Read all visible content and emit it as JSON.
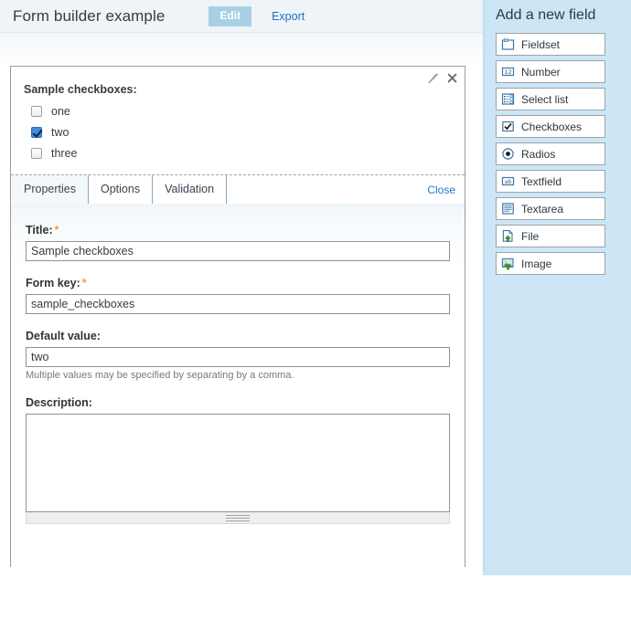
{
  "header": {
    "title": "Form builder example",
    "edit_label": "Edit",
    "export_label": "Export"
  },
  "preview": {
    "label": "Sample checkboxes:",
    "edit_icon": "pencil-icon",
    "close_icon": "close-icon",
    "checkboxes": [
      {
        "label": "one",
        "checked": false
      },
      {
        "label": "two",
        "checked": true
      },
      {
        "label": "three",
        "checked": false
      }
    ]
  },
  "tabs": {
    "items": [
      {
        "label": "Properties",
        "active": true
      },
      {
        "label": "Options",
        "active": false
      },
      {
        "label": "Validation",
        "active": false
      }
    ],
    "close_label": "Close"
  },
  "properties": {
    "title": {
      "label": "Title:",
      "required_marker": "*",
      "value": "Sample checkboxes",
      "placeholder": ""
    },
    "form_key": {
      "label": "Form key:",
      "required_marker": "*",
      "value": "sample_checkboxes",
      "placeholder": ""
    },
    "default_value": {
      "label": "Default value:",
      "value": "two",
      "placeholder": "",
      "hint": "Multiple values may be specified by separating by a comma."
    },
    "description": {
      "label": "Description:",
      "value": "",
      "placeholder": ""
    }
  },
  "sidebar": {
    "title": "Add a new field",
    "items": [
      {
        "label": "Fieldset",
        "icon": "fieldset-icon"
      },
      {
        "label": "Number",
        "icon": "number-icon"
      },
      {
        "label": "Select list",
        "icon": "select-list-icon"
      },
      {
        "label": "Checkboxes",
        "icon": "checkboxes-icon"
      },
      {
        "label": "Radios",
        "icon": "radios-icon"
      },
      {
        "label": "Textfield",
        "icon": "textfield-icon"
      },
      {
        "label": "Textarea",
        "icon": "textarea-icon"
      },
      {
        "label": "File",
        "icon": "file-upload-icon"
      },
      {
        "label": "Image",
        "icon": "image-upload-icon"
      }
    ]
  },
  "colors": {
    "accent_blue": "#1f6fc4",
    "edit_button_bg": "#a9cfe5",
    "sidebar_bg": "#cde6f5",
    "required_orange": "#f5a623",
    "checked_blue": "#3f8ddc"
  }
}
